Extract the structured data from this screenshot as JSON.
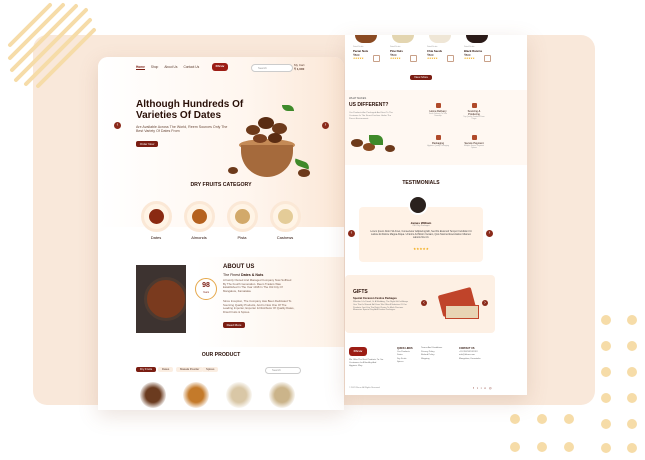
{
  "colors": {
    "brand": "#7a1d12",
    "accent": "#f0a400",
    "panel": "#f9e8da"
  },
  "left_page": {
    "nav": [
      "Home",
      "Shop",
      "About Us",
      "Contact Us"
    ],
    "logo": "Dhruv",
    "search_placeholder": "Search",
    "cart_label": "My Cart",
    "cart_value": "₹ 1,000",
    "hero": {
      "title": "Although Hundreds Of Varieties Of Dates",
      "subtitle": "Are Available Across The World, Reem Sources Only The Best Variety Of Dates From",
      "button": "Order Now"
    },
    "category_title": "DRY FRUITS CATEGORY",
    "categories": [
      "Dates",
      "Almonds",
      "Pista",
      "Cashews"
    ],
    "about": {
      "heading": "ABOUT US",
      "sub_prefix": "The Finest",
      "sub_bold": "Dates & Nuts",
      "para1": "A Family Owned And Managed Company Now Suffixed By The Fourth Generation. Reem Traders Was Established In The Year 1918 In The Old City Of Mangalore, Karnataka.",
      "para2": "Since Inception, The Company Has Been Dedicated To Sourcing Quality Products, And Is Now One Of The Leading Importer, Exporter & Distributor Of Quality Dates, Dried Fruits & Spices.",
      "button": "Read More",
      "badge_number": "98",
      "badge_text": "Years"
    },
    "product_title": "OUR PRODUCT",
    "product_tabs": [
      "Dry Fruits",
      "Dates",
      "Masala Powder",
      "Spices"
    ]
  },
  "right_page": {
    "products": [
      {
        "cat": "Dried Fruits",
        "name": "Pecan Nuts",
        "price": "₹500",
        "stars": "★★★★★"
      },
      {
        "cat": "Dried Fruits",
        "name": "Pine Nuts",
        "price": "₹500",
        "stars": "★★★★★"
      },
      {
        "cat": "Dried Fruits",
        "name": "Chia Seeds",
        "price": "₹500",
        "stars": "★★★★★"
      },
      {
        "cat": "Dried Fruits",
        "name": "Black Raisins",
        "price": "₹500",
        "stars": "★★★★★"
      }
    ],
    "view_more": "View More",
    "why": {
      "label": "WHAT MAKES",
      "heading": "US DIFFERENT?",
      "para": "Our Products Are Packaged And Sent To The Customer In The Finest Fashion Under The Purest Environment.",
      "features": [
        {
          "title": "Home Delivery",
          "desc": "Fresh Delivery To Your Doorstep"
        },
        {
          "title": "Sourcing & Producing",
          "desc": "Top Quality Products From Origin"
        },
        {
          "title": "Packaging",
          "desc": "Hygienic Quality Packaging"
        },
        {
          "title": "Secure Payment",
          "desc": "Multiple Secure Payment Options"
        }
      ]
    },
    "testimonials": {
      "heading": "TESTIMONIALS",
      "name": "James William",
      "role": "CEO Dry Packages",
      "quote": "Lorem Ipsum Dolor Sit Amet, Consectetur Adipiscing Elit, Sed Do Eiusmod Tempor Incididunt Ut Labore Et Dolore Magna Aliqua. Ut Enim Ad Minim Veniam, Quis Nostrud Exercitation Ullamco Laboris Nisi Ut.",
      "stars": "★★★★★"
    },
    "gifts": {
      "heading": "GIFTS",
      "sub": "Special Occasion Festive Packages",
      "para": "Whether It Is Diwali, Or A Wedding, The Right Gift Is Always One That Is Shared. At Dhruv We Offer A Selection Of Our Products Just Like The Right Choice To Mark Precious Memories Special Day And Festive Packages."
    },
    "footer": {
      "logo": "Dhruv",
      "tagline": "We Offer The Best Products To Our Customers In A Healthy And Hygienic Way",
      "cols": [
        {
          "head": "QUICK LINKS",
          "items": [
            "Our Products",
            "Dates",
            "Dry Fruits",
            "Spices"
          ]
        },
        {
          "head": "",
          "items": [
            "Terms And Conditions",
            "Privacy Policy",
            "Refund Policy",
            "Shipping"
          ]
        },
        {
          "head": "CONTACT US",
          "items": [
            "+91 9XXXXXXXXX",
            "info@dhruv.com",
            "Mangalore, Karnataka"
          ]
        }
      ],
      "copyright": "© 2023 Dhruv. All Rights Reserved"
    }
  }
}
